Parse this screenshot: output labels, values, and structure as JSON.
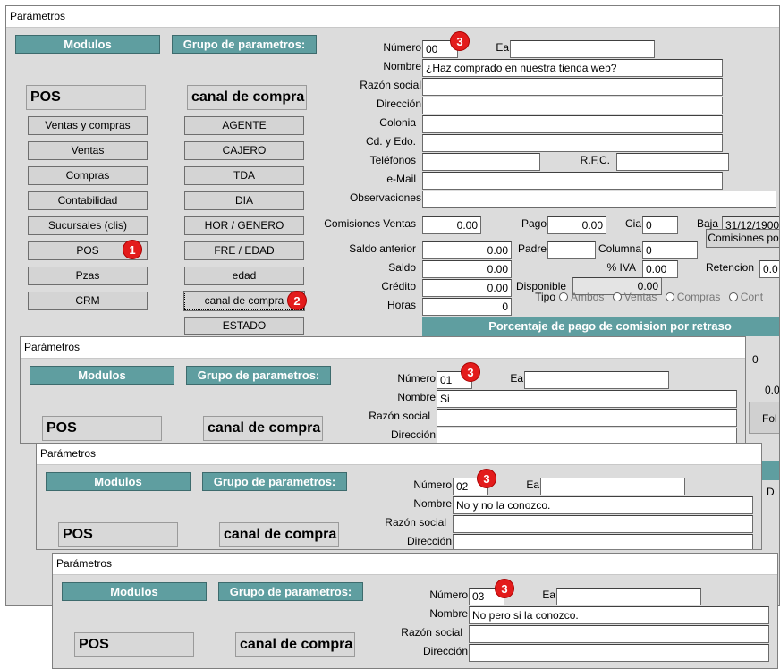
{
  "window_title": "Parámetros",
  "left": {
    "modulos_label": "Modulos",
    "grupo_label": "Grupo de parametros:",
    "module_value": "POS",
    "group_value": "canal de compra",
    "modules": [
      "Ventas y compras",
      "Ventas",
      "Compras",
      "Contabilidad",
      "Sucursales (clis)",
      "POS",
      "Pzas",
      "CRM"
    ],
    "groups": [
      "AGENTE",
      "CAJERO",
      "TDA",
      "DIA",
      "HOR / GENERO",
      "FRE / EDAD",
      "edad",
      "canal de compra",
      "ESTADO"
    ]
  },
  "labels": {
    "numero": "Número",
    "ea": "Ea",
    "nombre": "Nombre",
    "razon": "Razón social",
    "direccion": "Dirección",
    "colonia": "Colonia",
    "cd": "Cd. y Edo.",
    "telefonos": "Teléfonos",
    "rfc": "R.F.C.",
    "email": "e-Mail",
    "observaciones": "Observaciones",
    "comisiones": "Comisiones Ventas",
    "pago": "Pago",
    "cia": "Cia",
    "baja": "Baja",
    "saldo_ant": "Saldo anterior",
    "padre": "Padre",
    "columna": "Columna",
    "saldo": "Saldo",
    "iva": "% IVA",
    "retencion": "Retencion",
    "credito": "Crédito",
    "disponible": "Disponible",
    "horas": "Horas",
    "tipo": "Tipo",
    "comisiones_btn": "Comisiones po",
    "porcentaje": "Porcentaje de pago de comision por retraso",
    "fo": "Fol",
    "d": "D"
  },
  "main_values": {
    "comisiones": "0.00",
    "pago": "0.00",
    "cia": "0",
    "baja": "31/12/1900",
    "saldo_ant": "0.00",
    "columna": "0",
    "saldo": "0.00",
    "iva": "0.00",
    "retencion": "0.0",
    "credito": "0.00",
    "disponible": "0.00",
    "horas": "0",
    "side_0": "0",
    "side_00": "0.0"
  },
  "radio_options": [
    "Ambos",
    "Ventas",
    "Compras",
    "Cont"
  ],
  "records": [
    {
      "numero": "00",
      "nombre": "¿Haz comprado en nuestra tienda web?"
    },
    {
      "numero": "01",
      "nombre": "Si"
    },
    {
      "numero": "02",
      "nombre": "No y no la conozco."
    },
    {
      "numero": "03",
      "nombre": "No pero si la conozco."
    }
  ],
  "badges": {
    "one": "1",
    "two": "2",
    "three": "3"
  },
  "colors": {
    "teal": "#5f9ea0",
    "badge": "#e31b1b"
  }
}
